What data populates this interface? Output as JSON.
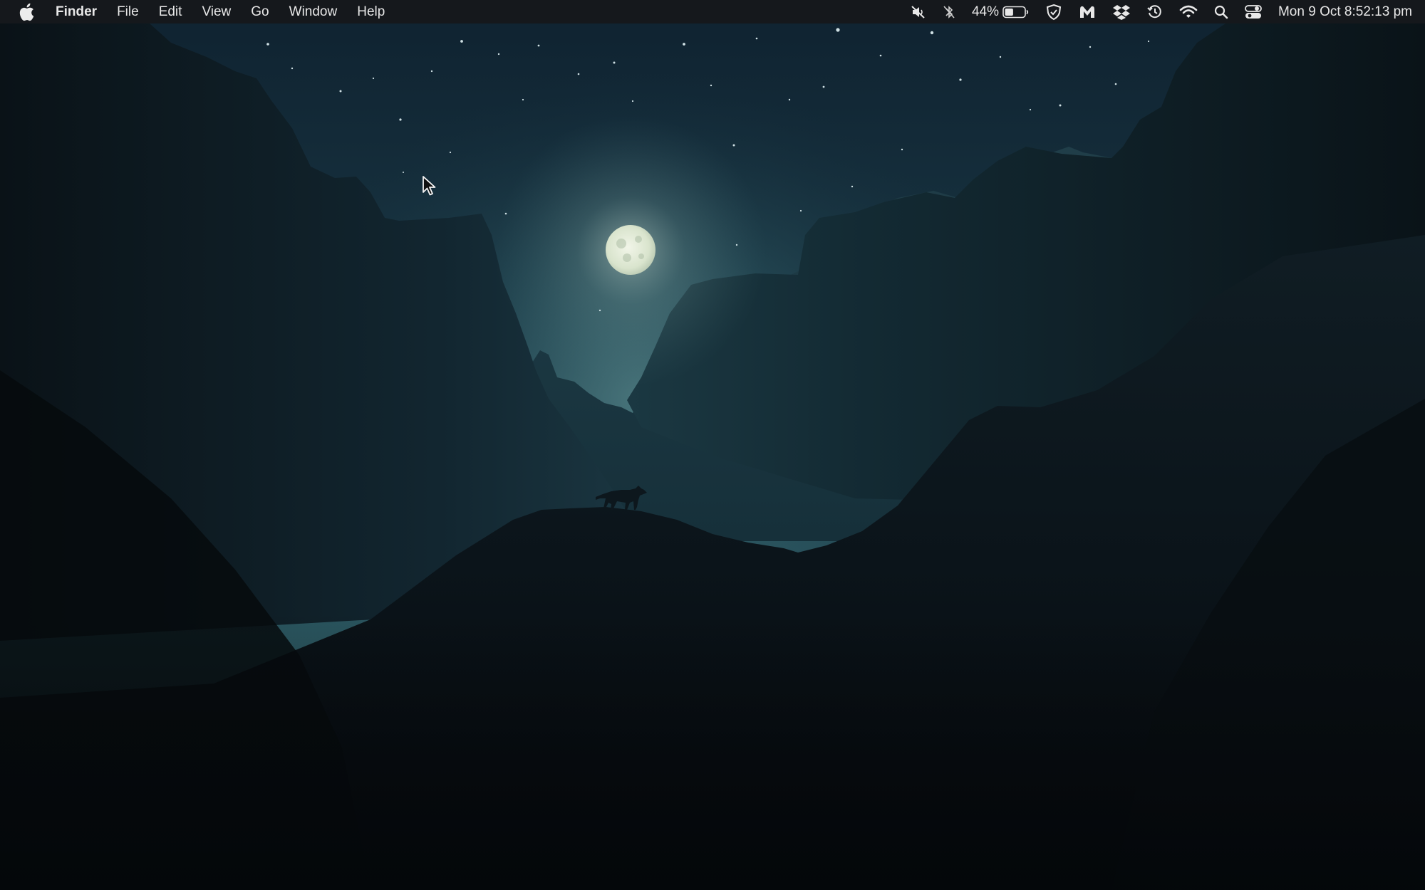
{
  "menubar": {
    "app_name": "Finder",
    "menus": [
      "File",
      "Edit",
      "View",
      "Go",
      "Window",
      "Help"
    ],
    "icons": {
      "apple": "apple-logo-icon",
      "mute": "speaker-muted-icon",
      "bluetooth": "bluetooth-off-icon",
      "battery": "battery-icon",
      "vpn": "shield-check-icon",
      "malwarebytes": "malwarebytes-icon",
      "dropbox": "dropbox-icon",
      "time_machine": "time-machine-icon",
      "wifi": "wifi-icon",
      "spotlight": "search-icon",
      "control_center": "control-center-icon"
    },
    "battery": {
      "percent_label": "44%",
      "level": 0.44
    },
    "date": "Mon 9 Oct",
    "time": "8:52:13 pm"
  },
  "wallpaper": {
    "icon": "night-canyon-moon-wolf-wallpaper",
    "colors": {
      "sky_top": "#112634",
      "sky_glow": "#4b7f86",
      "moon": "#e3ebd8",
      "far_cliff": "#1a3540",
      "near_cliff": "#0c151b",
      "ground": "#070b0e"
    }
  },
  "cursor": {
    "icon": "arrow-pointer-icon"
  }
}
